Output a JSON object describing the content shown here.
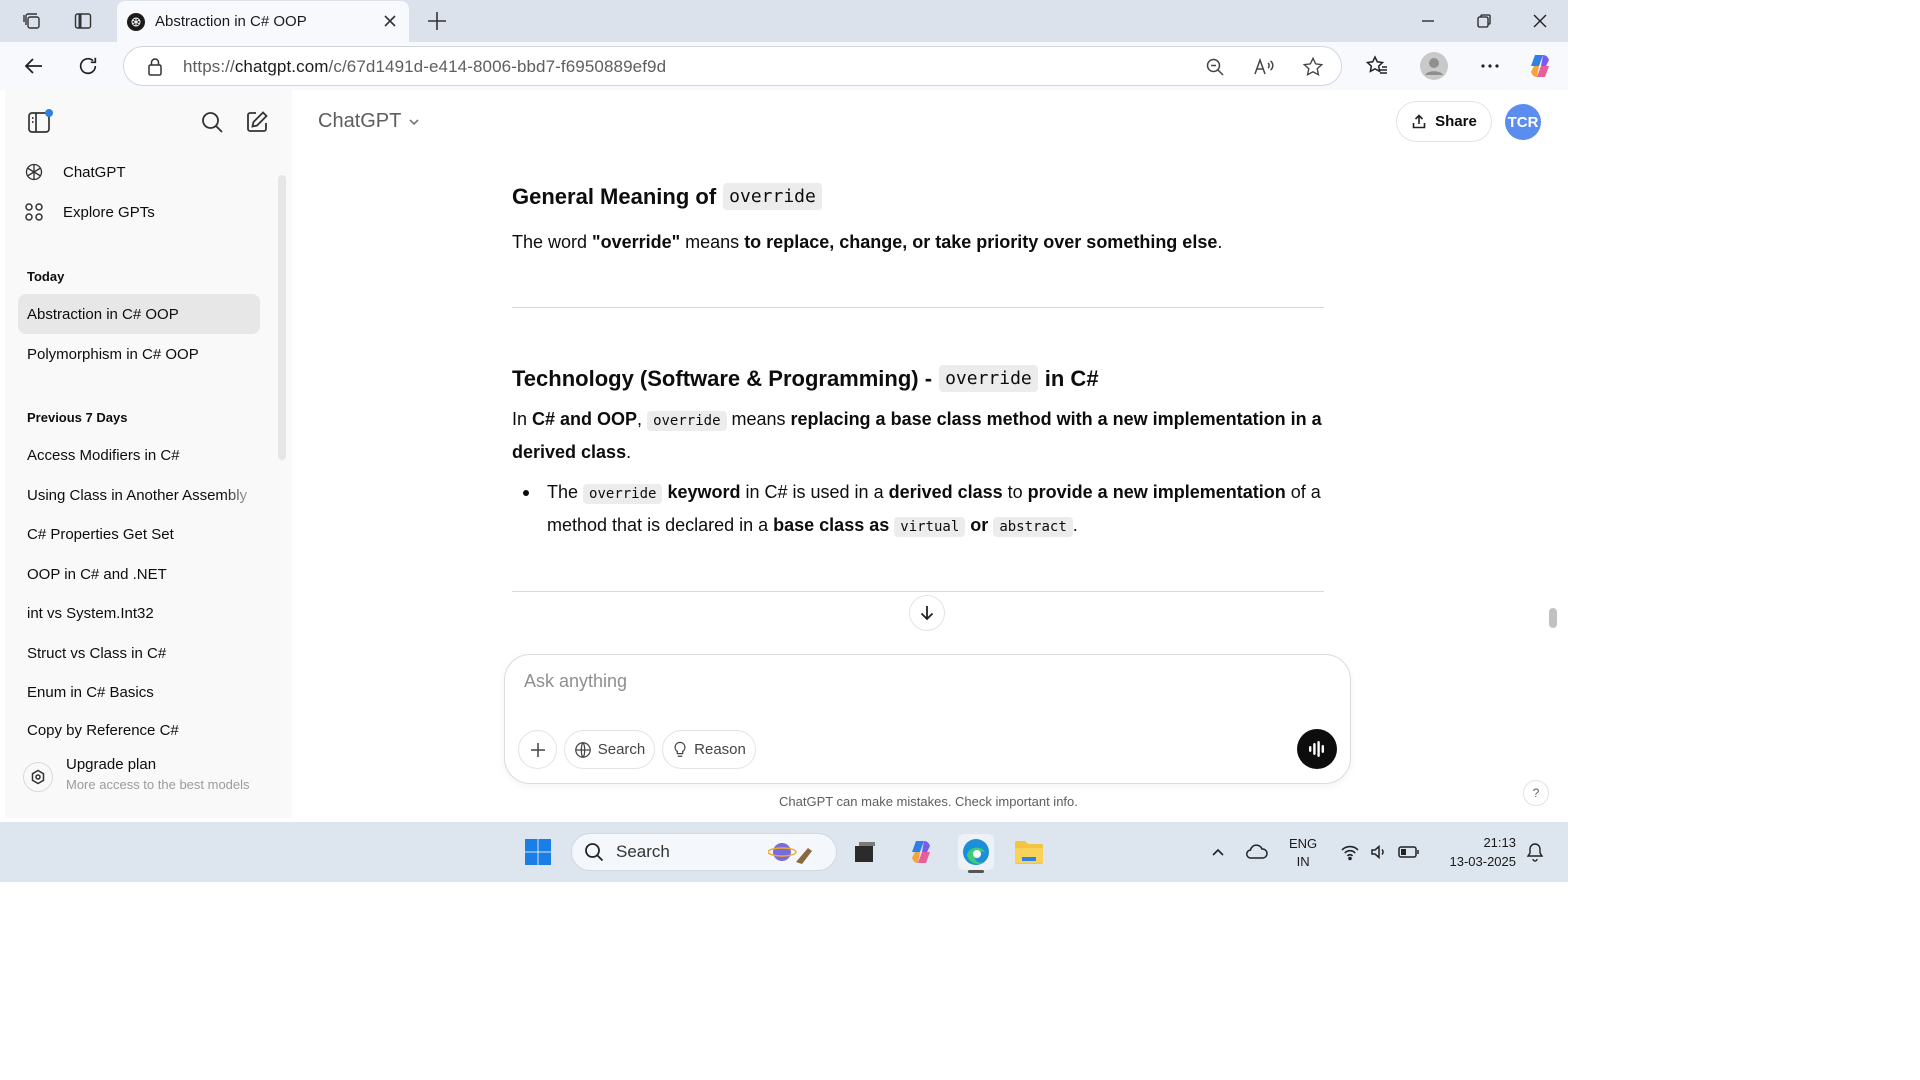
{
  "browser": {
    "tab_title": "Abstraction in C# OOP",
    "url_prefix": "https://",
    "url_domain": "chatgpt.com",
    "url_path": "/c/67d1491d-e414-8006-bbd7-f6950889ef9d"
  },
  "sidebar": {
    "top_items": [
      {
        "label": "ChatGPT",
        "icon": "chatgpt-logo-icon"
      },
      {
        "label": "Explore GPTs",
        "icon": "grid-icon"
      }
    ],
    "sections": [
      {
        "title": "Today",
        "items": [
          "Abstraction in C# OOP",
          "Polymorphism in C# OOP"
        ]
      },
      {
        "title": "Previous 7 Days",
        "items": [
          "Access Modifiers in C#",
          "Using Class in Another Assembly",
          "C# Properties Get Set",
          "OOP in C# and .NET",
          "int vs System.Int32",
          "Struct vs Class in C#",
          "Enum in C# Basics",
          "Copy by Reference C#"
        ]
      }
    ],
    "upgrade": {
      "title": "Upgrade plan",
      "subtitle": "More access to the best models"
    }
  },
  "header": {
    "model": "ChatGPT",
    "share_label": "Share",
    "avatar_initials": "TCR"
  },
  "content": {
    "h1_text": "General Meaning of",
    "h1_code": "override",
    "p1_a": "The word ",
    "p1_b": "\"override\"",
    "p1_c": " means ",
    "p1_d": "to replace, change, or take priority over something else",
    "p1_e": ".",
    "h2_text": "Technology (Software & Programming) -",
    "h2_code": "override",
    "h2_tail": "in C#",
    "p2_a": "In ",
    "p2_b": "C# and OOP",
    "p2_c": ", ",
    "p2_code": "override",
    "p2_d": " means ",
    "p2_e": "replacing a base class method with a new implementation in a derived class",
    "p2_f": ".",
    "li_a": "The ",
    "li_code": "override",
    "li_b": " keyword",
    "li_c": " in C# is used in a ",
    "li_d": "derived class",
    "li_e": " to ",
    "li_f": "provide a new implementation",
    "li_g": " of a method that is declared in a ",
    "li_h": "base class as",
    "li_code2": "virtual",
    "li_i": "or",
    "li_code3": "abstract",
    "li_j": "."
  },
  "composer": {
    "placeholder": "Ask anything",
    "search_label": "Search",
    "reason_label": "Reason",
    "disclaimer": "ChatGPT can make mistakes. Check important info.",
    "help": "?"
  },
  "taskbar": {
    "search_label": "Search",
    "lang_line1": "ENG",
    "lang_line2": "IN",
    "time": "21:13",
    "date": "13-03-2025"
  }
}
